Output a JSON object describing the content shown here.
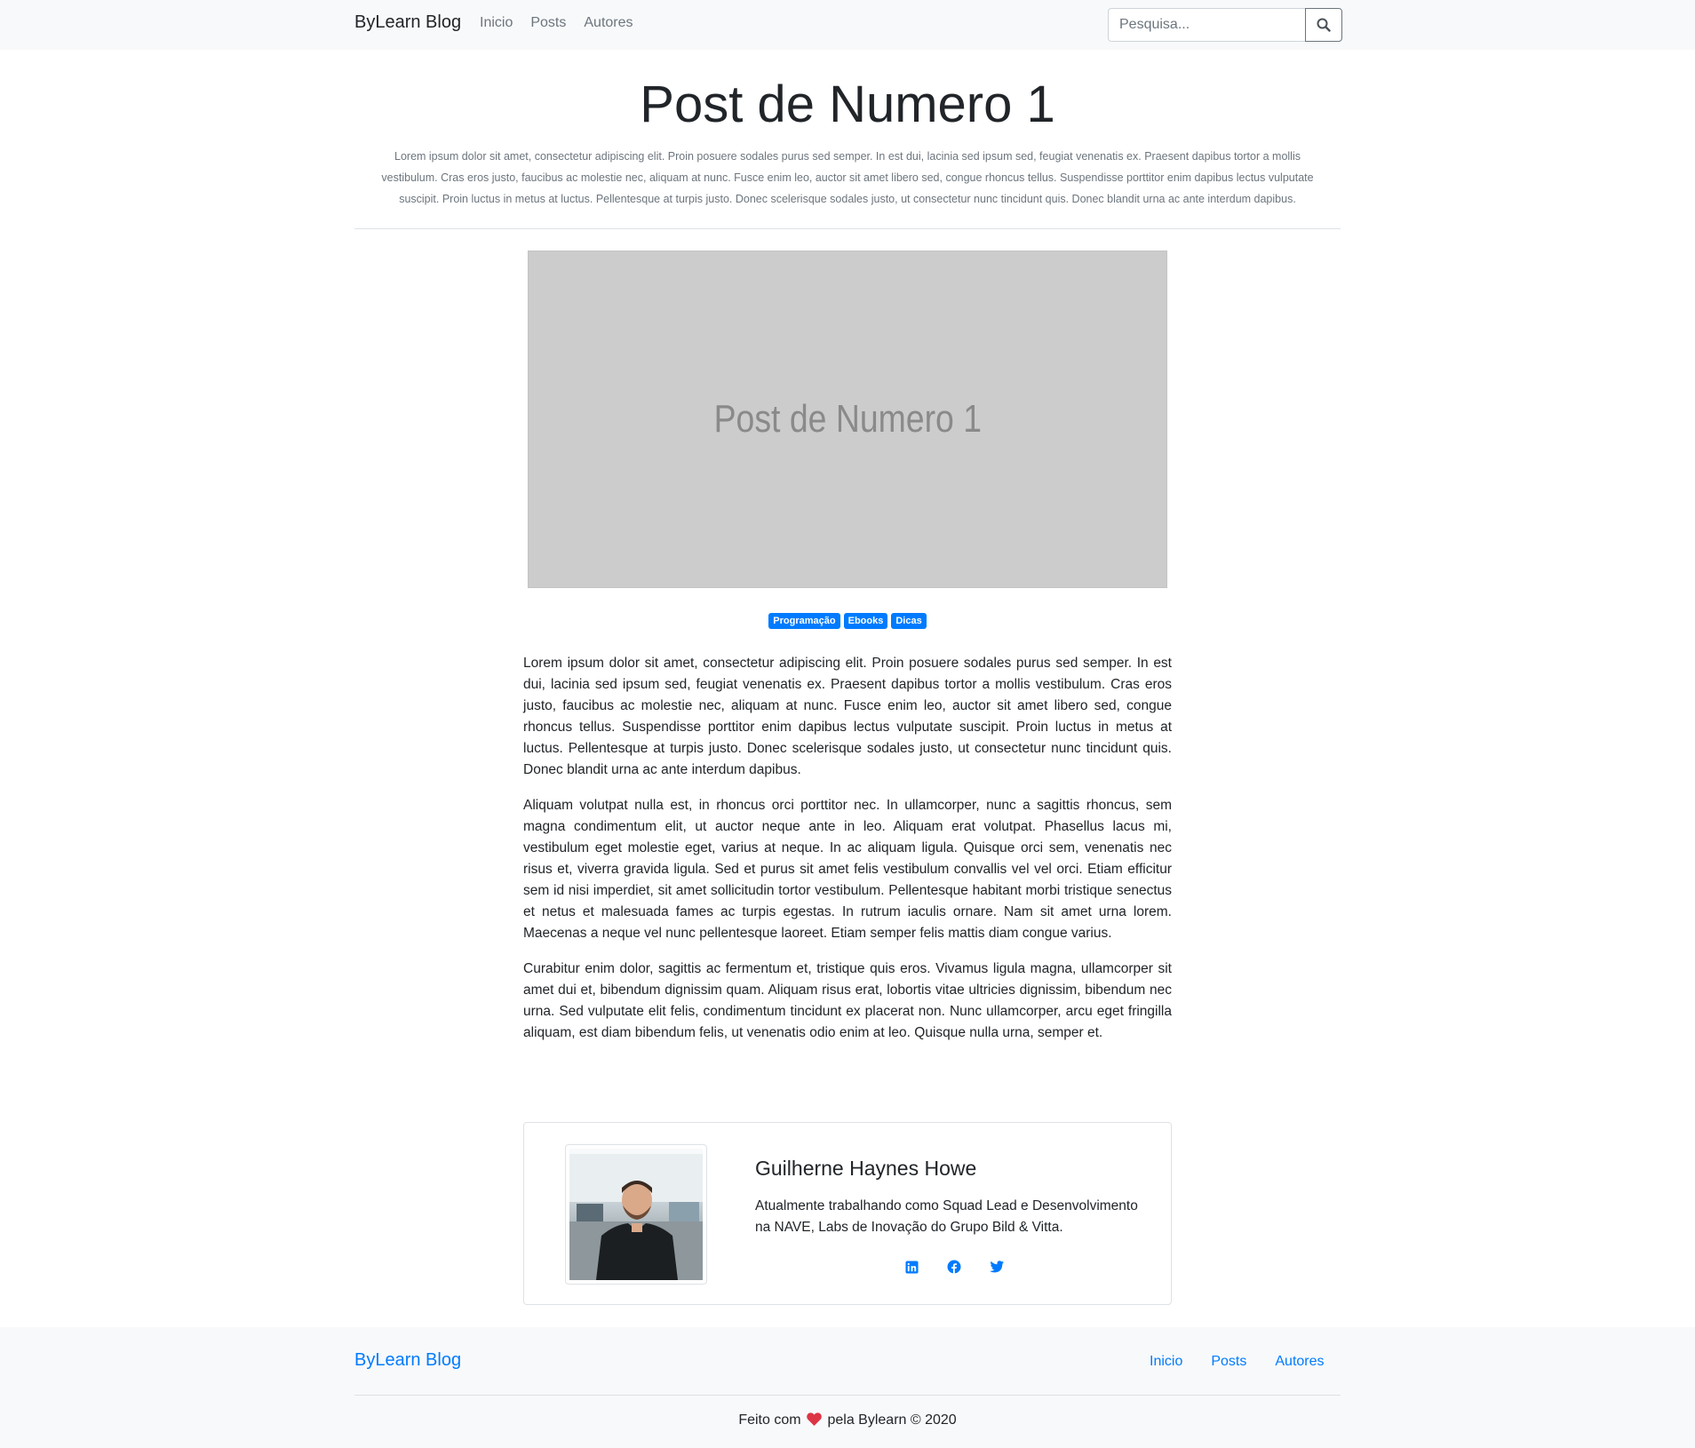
{
  "navbar": {
    "brand": "ByLearn Blog",
    "links": [
      "Inicio",
      "Posts",
      "Autores"
    ],
    "search_placeholder": "Pesquisa..."
  },
  "post": {
    "title": "Post de Numero 1",
    "summary": "Lorem ipsum dolor sit amet, consectetur adipiscing elit. Proin posuere sodales purus sed semper. In est dui, lacinia sed ipsum sed, feugiat venenatis ex. Praesent dapibus tortor a mollis vestibulum. Cras eros justo, faucibus ac molestie nec, aliquam at nunc. Fusce enim leo, auctor sit amet libero sed, congue rhoncus tellus. Suspendisse porttitor enim dapibus lectus vulputate suscipit. Proin luctus in metus at luctus. Pellentesque at turpis justo. Donec scelerisque sodales justo, ut consectetur nunc tincidunt quis. Donec blandit urna ac ante interdum dapibus.",
    "image_text": "Post de Numero 1",
    "tags": [
      "Programação",
      "Ebooks",
      "Dicas"
    ],
    "paragraphs": [
      "Lorem ipsum dolor sit amet, consectetur adipiscing elit. Proin posuere sodales purus sed semper. In est dui, lacinia sed ipsum sed, feugiat venenatis ex. Praesent dapibus tortor a mollis vestibulum. Cras eros justo, faucibus ac molestie nec, aliquam at nunc. Fusce enim leo, auctor sit amet libero sed, congue rhoncus tellus. Suspendisse porttitor enim dapibus lectus vulputate suscipit. Proin luctus in metus at luctus. Pellentesque at turpis justo. Donec scelerisque sodales justo, ut consectetur nunc tincidunt quis. Donec blandit urna ac ante interdum dapibus.",
      "Aliquam volutpat nulla est, in rhoncus orci porttitor nec. In ullamcorper, nunc a sagittis rhoncus, sem magna condimentum elit, ut auctor neque ante in leo. Aliquam erat volutpat. Phasellus lacus mi, vestibulum eget molestie eget, varius at neque. In ac aliquam ligula. Quisque orci sem, venenatis nec risus et, viverra gravida ligula. Sed et purus sit amet felis vestibulum convallis vel vel orci. Etiam efficitur sem id nisi imperdiet, sit amet sollicitudin tortor vestibulum. Pellentesque habitant morbi tristique senectus et netus et malesuada fames ac turpis egestas. In rutrum iaculis ornare. Nam sit amet urna lorem. Maecenas a neque vel nunc pellentesque laoreet. Etiam semper felis mattis diam congue varius.",
      "Curabitur enim dolor, sagittis ac fermentum et, tristique quis eros. Vivamus ligula magna, ullamcorper sit amet dui et, bibendum dignissim quam. Aliquam risus erat, lobortis vitae ultricies dignissim, bibendum nec urna. Sed vulputate elit felis, condimentum tincidunt ex placerat non. Nunc ullamcorper, arcu eget fringilla aliquam, est diam bibendum felis, ut venenatis odio enim at leo. Quisque nulla urna, semper et."
    ]
  },
  "author": {
    "name": "Guilherne Haynes Howe",
    "bio": "Atualmente trabalhando como Squad Lead e Desenvolvimento na NAVE, Labs de Inovação do Grupo Bild & Vitta.",
    "socials": [
      "linkedin-icon",
      "facebook-icon",
      "twitter-icon"
    ]
  },
  "footer": {
    "brand": "ByLearn Blog",
    "links": [
      "Inicio",
      "Posts",
      "Autores"
    ],
    "copy_before": "Feito com",
    "copy_after": "pela Bylearn © 2020"
  },
  "colors": {
    "primary": "#007bff",
    "navbar_bg": "#f8f9fa",
    "heart": "#dc3545",
    "placeholder_bg": "#cccccc"
  }
}
